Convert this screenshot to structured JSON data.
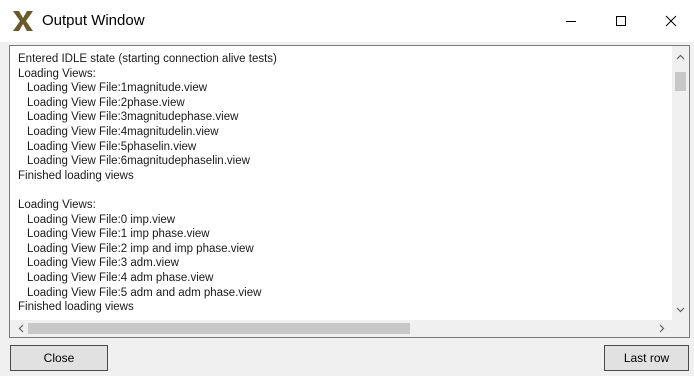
{
  "window": {
    "title": "Output Window",
    "app_icon": "x-logo-icon",
    "controls": [
      "minimize-icon",
      "maximize-icon",
      "close-icon"
    ]
  },
  "output": {
    "lines": [
      {
        "text": "Entered IDLE state (starting connection alive tests)",
        "indent": false
      },
      {
        "text": "Loading Views:",
        "indent": false
      },
      {
        "text": "Loading View File:1magnitude.view",
        "indent": true
      },
      {
        "text": "Loading View File:2phase.view",
        "indent": true
      },
      {
        "text": "Loading View File:3magnitudephase.view",
        "indent": true
      },
      {
        "text": "Loading View File:4magnitudelin.view",
        "indent": true
      },
      {
        "text": "Loading View File:5phaselin.view",
        "indent": true
      },
      {
        "text": "Loading View File:6magnitudephaselin.view",
        "indent": true
      },
      {
        "text": "Finished loading views",
        "indent": false
      },
      {
        "text": "",
        "indent": false
      },
      {
        "text": "Loading Views:",
        "indent": false
      },
      {
        "text": "Loading View File:0 imp.view",
        "indent": true
      },
      {
        "text": "Loading View File:1 imp phase.view",
        "indent": true
      },
      {
        "text": "Loading View File:2 imp and imp phase.view",
        "indent": true
      },
      {
        "text": "Loading View File:3 adm.view",
        "indent": true
      },
      {
        "text": "Loading View File:4 adm phase.view",
        "indent": true
      },
      {
        "text": "Loading View File:5 adm and adm phase.view",
        "indent": true
      },
      {
        "text": "Finished loading views",
        "indent": false
      }
    ]
  },
  "buttons": {
    "close_label": "Close",
    "last_row_label": "Last row"
  },
  "colors": {
    "background": "#f0f0f0",
    "app_icon": "#6b5a2a"
  }
}
